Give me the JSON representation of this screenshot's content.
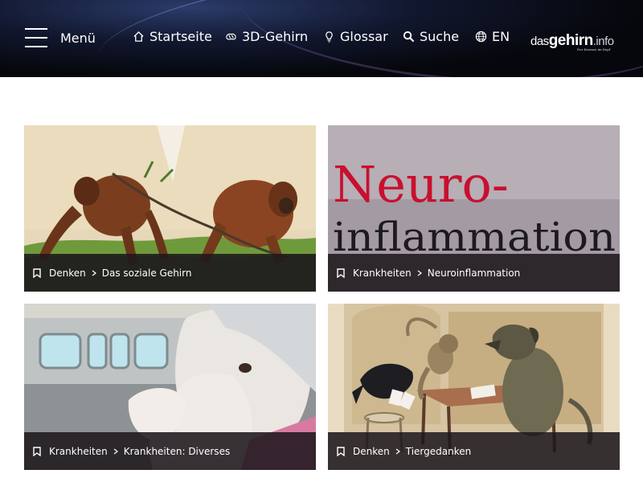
{
  "header": {
    "menu_label": "Menü",
    "nav": [
      {
        "label": "Startseite",
        "icon": "home-icon"
      },
      {
        "label": "3D-Gehirn",
        "icon": "brain-icon"
      },
      {
        "label": "Glossar",
        "icon": "lightbulb-icon"
      },
      {
        "label": "Suche",
        "icon": "search-icon"
      },
      {
        "label": "EN",
        "icon": "globe-icon"
      }
    ],
    "logo": {
      "part1": "das",
      "part2": "gehirn",
      "part3": ".info",
      "tagline": "Der Kosmos im Kopf"
    }
  },
  "cards": [
    {
      "category": "Denken",
      "subcategory": "Das soziale Gehirn",
      "image": "orangutans-illustration"
    },
    {
      "category": "Krankheiten",
      "subcategory": "Neuroinflammation",
      "image": "neuroinflammation-typography",
      "art_text_1": "Neuro-",
      "art_text_2": "inflammation"
    },
    {
      "category": "Krankheiten",
      "subcategory": "Krankheiten: Diverses",
      "image": "elderly-man-train-illustration"
    },
    {
      "category": "Denken",
      "subcategory": "Tiergedanken",
      "image": "animals-cards-illustration"
    }
  ],
  "colors": {
    "header_bg": "#06070c",
    "bar_bg": "#1e181c",
    "neuro_red": "#c8102e"
  }
}
